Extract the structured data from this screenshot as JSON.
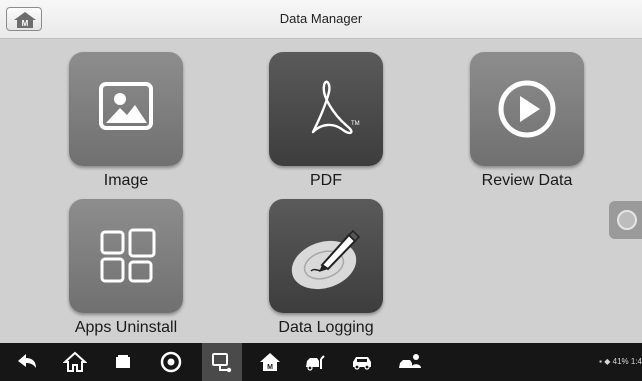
{
  "header": {
    "title": "Data Manager",
    "home_icon_letter": "M"
  },
  "tiles": [
    {
      "label": "Image",
      "icon": "image-icon"
    },
    {
      "label": "PDF",
      "icon": "pdf-icon"
    },
    {
      "label": "Review Data",
      "icon": "play-icon"
    },
    {
      "label": "Apps Uninstall",
      "icon": "apps-icon"
    },
    {
      "label": "Data Logging",
      "icon": "data-logging-icon"
    }
  ],
  "navbar": {
    "items": [
      "back-icon",
      "home-icon",
      "recent-apps-icon",
      "browser-icon",
      "vci-icon",
      "maxisys-home-icon",
      "vehicle-service-icon",
      "car-icon",
      "user-car-icon"
    ],
    "active_item": "vci-icon",
    "status_text": "41% 1:4",
    "background": "#161616"
  }
}
